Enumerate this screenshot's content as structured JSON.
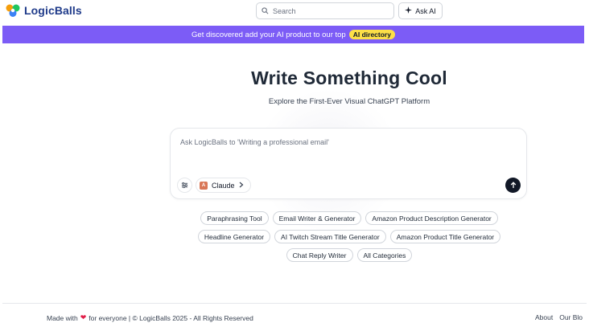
{
  "header": {
    "logo_text": "LogicBalls",
    "search_placeholder": "Search",
    "ask_ai_label": "Ask AI"
  },
  "banner": {
    "text": "Get discovered add your AI product to our top",
    "badge": "AI directory",
    "bg_color": "#7c5cf6",
    "badge_color": "#fde047"
  },
  "hero": {
    "title": "Write Something Cool",
    "subtitle": "Explore the First-Ever Visual ChatGPT Platform"
  },
  "prompt": {
    "placeholder": "Ask LogicBalls to 'Writing a professional email'",
    "model_label": "Claude",
    "model_icon_letter": "A"
  },
  "suggestions": {
    "row1": [
      "Paraphrasing Tool",
      "Email Writer & Generator",
      "Amazon Product Description Generator"
    ],
    "row2": [
      "Headline Generator",
      "AI Twitch Stream Title Generator",
      "Amazon Product Title Generator"
    ],
    "row3": [
      "Chat Reply Writer",
      "All Categories"
    ]
  },
  "footer": {
    "made_with": "Made with",
    "for_everyone": "for everyone | © LogicBalls 2025 - All Rights Reserved",
    "links": [
      "About",
      "Our Blo"
    ]
  }
}
